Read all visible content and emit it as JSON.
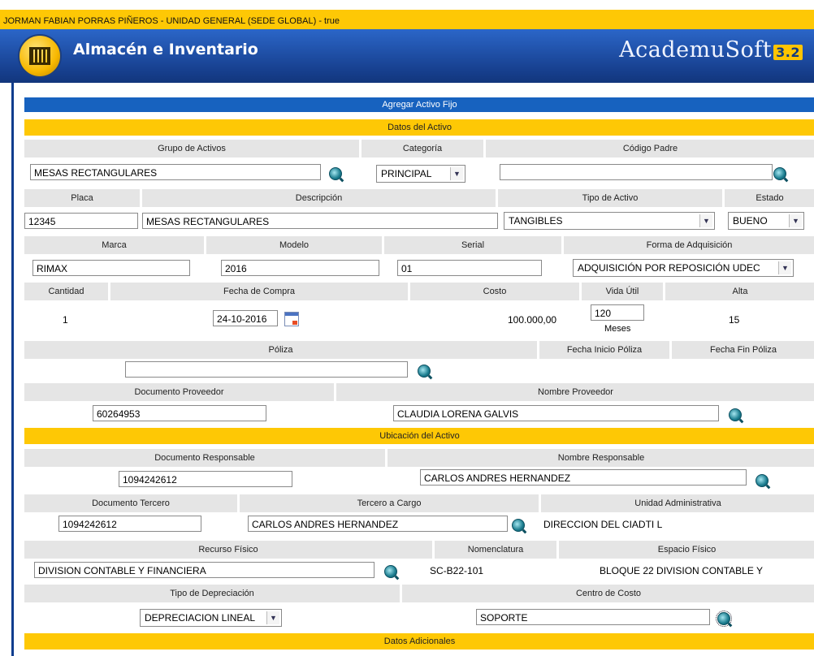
{
  "top_bar": {
    "user_info": "JORMAN FABIAN PORRAS PIÑEROS - UNIDAD GENERAL (SEDE GLOBAL) - true"
  },
  "header": {
    "title": "Almacén e Inventario",
    "brand": "AcademuSoft",
    "version": "3.2"
  },
  "form": {
    "title": "Agregar Activo Fijo",
    "sections": {
      "datos": "Datos del Activo",
      "ubicacion": "Ubicación del Activo",
      "adicionales": "Datos Adicionales"
    },
    "labels": {
      "grupo_activos": "Grupo de Activos",
      "categoria": "Categoría",
      "codigo_padre": "Código Padre",
      "placa": "Placa",
      "descripcion": "Descripción",
      "tipo_activo": "Tipo de Activo",
      "estado": "Estado",
      "marca": "Marca",
      "modelo": "Modelo",
      "serial": "Serial",
      "forma_adquisicion": "Forma de Adquisición",
      "cantidad": "Cantidad",
      "fecha_compra": "Fecha de Compra",
      "costo": "Costo",
      "vida_util": "Vida Útil",
      "alta": "Alta",
      "poliza": "Póliza",
      "fecha_inicio_poliza": "Fecha Inicio Póliza",
      "fecha_fin_poliza": "Fecha Fin Póliza",
      "documento_proveedor": "Documento Proveedor",
      "nombre_proveedor": "Nombre Proveedor",
      "documento_responsable": "Documento Responsable",
      "nombre_responsable": "Nombre Responsable",
      "documento_tercero": "Documento Tercero",
      "tercero_cargo": "Tercero a Cargo",
      "unidad_administrativa": "Unidad Administrativa",
      "recurso_fisico": "Recurso Físico",
      "nomenclatura": "Nomenclatura",
      "espacio_fisico": "Espacio Físico",
      "tipo_depreciacion": "Tipo de Depreciación",
      "centro_costo": "Centro de Costo",
      "meses": "Meses"
    },
    "values": {
      "grupo_activos": "MESAS RECTANGULARES",
      "categoria": "PRINCIPAL",
      "codigo_padre": "",
      "placa": "12345",
      "descripcion": "MESAS RECTANGULARES",
      "tipo_activo": "TANGIBLES",
      "estado": "BUENO",
      "marca": "RIMAX",
      "modelo": "2016",
      "serial": "01",
      "forma_adquisicion": "ADQUISICIÓN POR REPOSICIÓN UDEC",
      "cantidad": "1",
      "fecha_compra": "24-10-2016",
      "costo": "100.000,00",
      "vida_util": "120",
      "alta": "15",
      "poliza": "",
      "documento_proveedor": "60264953",
      "nombre_proveedor": "CLAUDIA LORENA GALVIS",
      "documento_responsable": "1094242612",
      "nombre_responsable": "CARLOS ANDRES HERNANDEZ",
      "documento_tercero": "1094242612",
      "tercero_cargo": "CARLOS ANDRES HERNANDEZ",
      "unidad_administrativa": "DIRECCION DEL CIADTI L",
      "recurso_fisico": "DIVISION CONTABLE Y FINANCIERA",
      "nomenclatura": "SC-B22-101",
      "espacio_fisico": "BLOQUE 22 DIVISION CONTABLE Y",
      "tipo_depreciacion": "DEPRECIACION LINEAL",
      "centro_costo": "SOPORTE"
    }
  },
  "colors": {
    "gold": "#fec805",
    "blue": "#1762bf",
    "header_gray": "#e5e5e5",
    "navy": "#0e3d8e"
  }
}
